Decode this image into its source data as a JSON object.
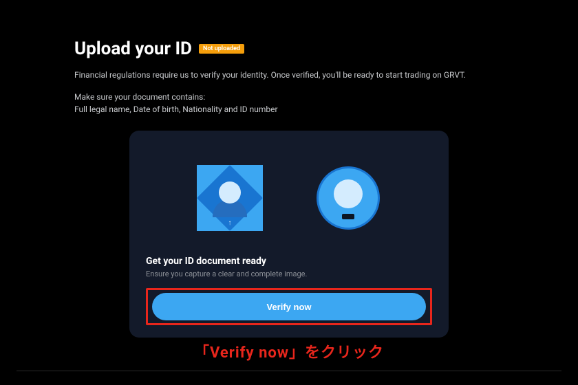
{
  "header": {
    "title": "Upload your ID",
    "badge": "Not uploaded"
  },
  "intro": {
    "description": "Financial regulations require us to verify your identity. Once verified, you'll be ready to start trading on GRVT.",
    "make_sure": "Make sure your document contains:",
    "requirements": "Full legal name, Date of birth, Nationality and ID number"
  },
  "card": {
    "heading": "Get your ID document ready",
    "subtext": "Ensure you capture a clear and complete image.",
    "button_label": "Verify now"
  },
  "annotation": {
    "text": "「Verify now」をクリック"
  }
}
